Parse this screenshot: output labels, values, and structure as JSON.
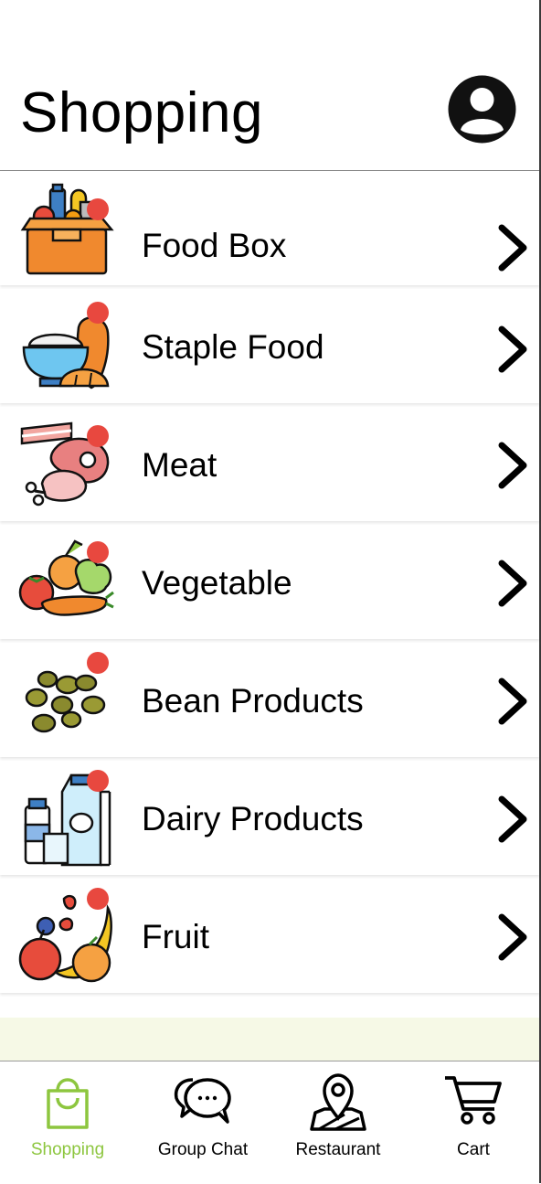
{
  "header": {
    "title": "Shopping"
  },
  "categories": [
    {
      "label": "Food Box",
      "icon": "food-box-icon"
    },
    {
      "label": "Staple Food",
      "icon": "rice-bread-icon"
    },
    {
      "label": "Meat",
      "icon": "meat-icon"
    },
    {
      "label": "Vegetable",
      "icon": "vegetable-icon"
    },
    {
      "label": "Bean Products",
      "icon": "beans-icon"
    },
    {
      "label": "Dairy Products",
      "icon": "milk-icon"
    },
    {
      "label": "Fruit",
      "icon": "fruit-icon"
    }
  ],
  "tabs": [
    {
      "label": "Shopping",
      "icon": "shopping-bag-icon",
      "active": true
    },
    {
      "label": "Group Chat",
      "icon": "chat-bubbles-icon",
      "active": false
    },
    {
      "label": "Restaurant",
      "icon": "map-pin-icon",
      "active": false
    },
    {
      "label": "Cart",
      "icon": "cart-icon",
      "active": false
    }
  ],
  "colors": {
    "accent": "#8dc63f",
    "badge": "#e8483f",
    "strip": "#f6f9e6"
  }
}
